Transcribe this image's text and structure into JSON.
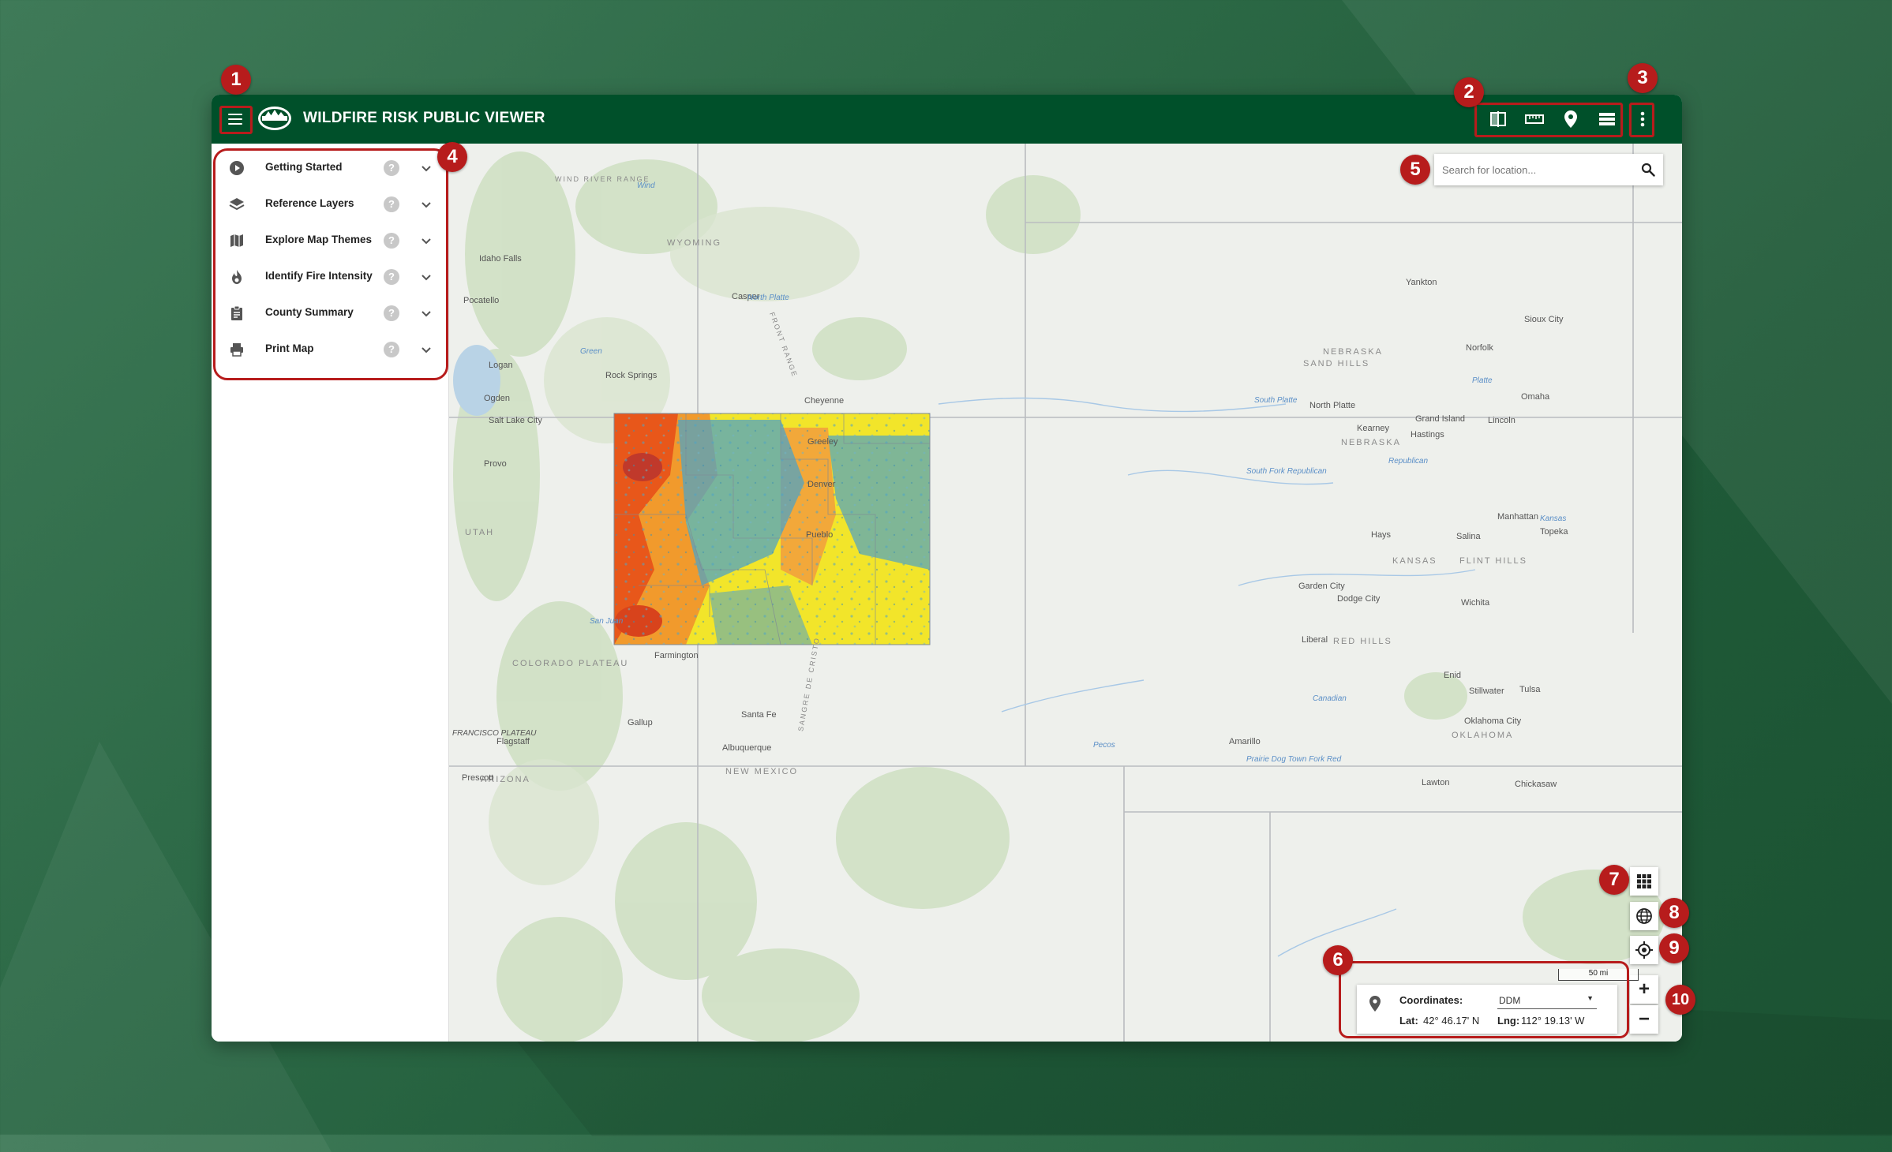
{
  "app": {
    "title": "WILDFIRE RISK PUBLIC VIEWER"
  },
  "sidebar": {
    "items": [
      {
        "label": "Getting Started",
        "icon": "play-circle-icon"
      },
      {
        "label": "Reference Layers",
        "icon": "layers-icon"
      },
      {
        "label": "Explore Map Themes",
        "icon": "map-icon"
      },
      {
        "label": "Identify Fire Intensity",
        "icon": "fire-icon"
      },
      {
        "label": "County Summary",
        "icon": "clipboard-icon"
      },
      {
        "label": "Print Map",
        "icon": "printer-icon"
      }
    ],
    "help_glyph": "?"
  },
  "toolbar": {
    "icons": [
      "split-view-icon",
      "ruler-icon",
      "map-pin-icon",
      "list-icon"
    ],
    "more_icon": "more-vertical-icon"
  },
  "search": {
    "placeholder": "Search for location..."
  },
  "map_controls": {
    "zoom_in": "+",
    "zoom_out": "−",
    "basemap_icon": "grid-icon",
    "globe_icon": "globe-icon",
    "locate_icon": "locate-icon"
  },
  "coordinates": {
    "label": "Coordinates:",
    "format": "DDM",
    "lat_label": "Lat:",
    "lat_value": "42° 46.17' N",
    "lng_label": "Lng:",
    "lng_value": "112° 19.13' W"
  },
  "scale": {
    "label": "50 mi"
  },
  "callouts": [
    "1",
    "2",
    "3",
    "4",
    "5",
    "6",
    "7",
    "8",
    "9",
    "10"
  ],
  "map_labels": {
    "states": [
      "WYOMING",
      "NEBRASKA",
      "SAND HILLS",
      "KANSAS",
      "FLINT HILLS",
      "UTAH",
      "COLORADO PLATEAU",
      "NEW MEXICO",
      "RED HILLS",
      "OKLAHOMA",
      "ARIZONA",
      "NEBRASKA"
    ],
    "cities": [
      "Idaho Falls",
      "Pocatello",
      "Logan",
      "Ogden",
      "Salt Lake City",
      "Provo",
      "Casper",
      "Rock Springs",
      "Cheyenne",
      "North Platte",
      "Kearney",
      "Grand Island",
      "Hastings",
      "Lincoln",
      "Omaha",
      "Norfolk",
      "Sioux City",
      "Yankton",
      "Hays",
      "Salina",
      "Manhattan",
      "Topeka",
      "Garden City",
      "Dodge City",
      "Wichita",
      "Liberal",
      "Enid",
      "Stillwater",
      "Tulsa",
      "Farmington",
      "Santa Fe",
      "Albuquerque",
      "Gallup",
      "Flagstaff",
      "Prescott",
      "Amarillo",
      "Lawton",
      "Chickasaw",
      "Oklahoma City",
      "Greeley",
      "Denver",
      "Pueblo"
    ],
    "waters": [
      "North Platte",
      "South Platte",
      "Platte",
      "Republican",
      "South Fork Republican",
      "Kansas",
      "Canadian",
      "Prairie Dog Town Fork Red",
      "Pecos",
      "Green",
      "San Juan",
      "Wind"
    ],
    "ranges": [
      "WIND RIVER RANGE",
      "FRONT RANGE",
      "SANGRE DE CRISTO",
      "FRANCISCO PLATEAU"
    ]
  },
  "colors": {
    "brand_green": "#00502a",
    "callout_red": "#b71c1c",
    "risk_high": "#e8571a",
    "risk_mid": "#f2e52a",
    "risk_low": "#4fa3c4"
  }
}
